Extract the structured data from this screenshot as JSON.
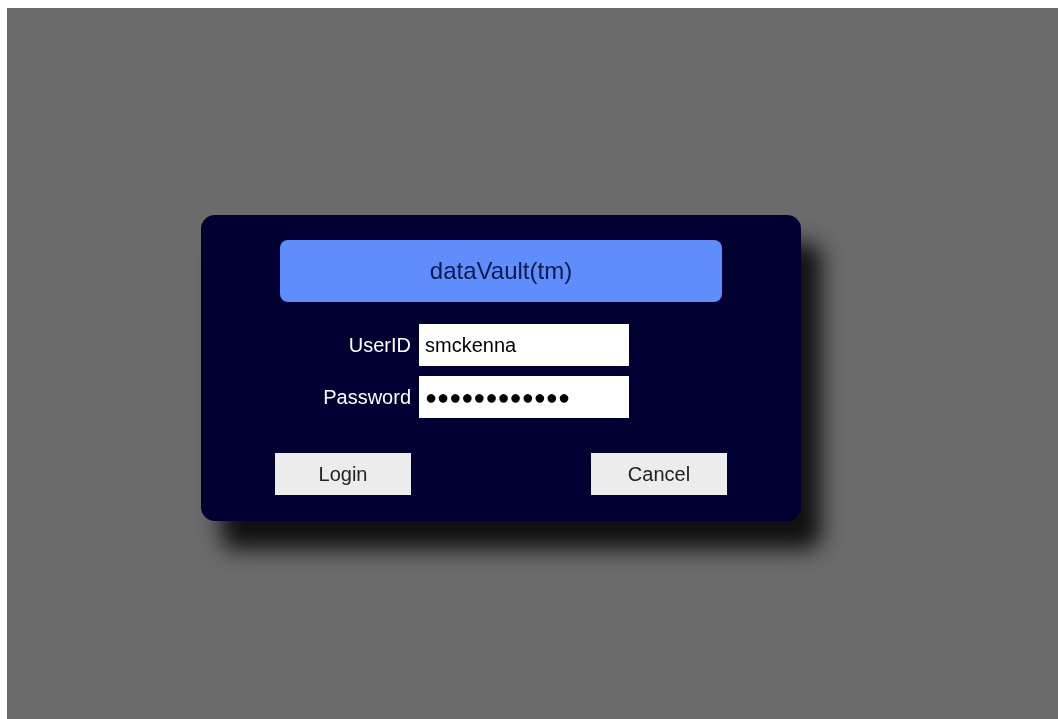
{
  "dialog": {
    "title": "dataVault(tm)",
    "fields": [
      {
        "label": "UserID",
        "value": "smckenna"
      },
      {
        "label": "Password",
        "value": "●●●●●●●●●●●●"
      }
    ],
    "buttons": [
      "Login",
      "Cancel"
    ]
  }
}
